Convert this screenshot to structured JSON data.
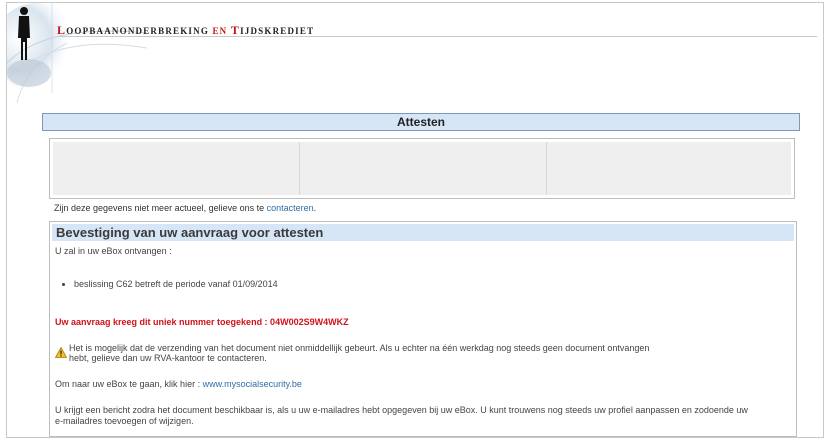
{
  "header": {
    "title_part1_cap": "L",
    "title_part1_rest": "OOPBAANONDERBREKING",
    "title_connector": "EN",
    "title_part2_cap": "T",
    "title_part2_rest": "IJDSKREDIET"
  },
  "attesten": {
    "heading": "Attesten"
  },
  "notice": {
    "text": "Zijn deze gegevens niet meer actueel, gelieve ons te ",
    "link": "contacteren",
    "suffix": "."
  },
  "confirmation": {
    "title": "Bevestiging van uw aanvraag voor attesten",
    "intro": "U zal in uw eBox ontvangen :",
    "items": [
      "beslissing C62 betreft de periode vanaf 01/09/2014"
    ],
    "unique_number": "Uw aanvraag kreeg dit uniek nummer toegekend : 04W002S9W4WKZ",
    "warning_line1": "Het is mogelijk dat de verzending van het document niet onmiddellijk gebeurt. Als u echter na één werkdag nog steeds geen document ontvangen",
    "warning_line2": "hebt, gelieve dan uw RVA-kantoor te contacteren.",
    "ebox_text": "Om naar uw eBox te gaan, klik hier : ",
    "ebox_link": "www.mysocialsecurity.be",
    "info_line1": "U krijgt een bericht zodra het document beschikbaar is, als u uw e-mailadres hebt opgegeven bij uw eBox. U kunt trouwens nog steeds uw profiel aanpassen en zodoende uw",
    "info_line2": "e-mailadres toevoegen of wijzigen."
  },
  "colors": {
    "brand_red": "#c0141b",
    "header_blue": "#d6e6f7",
    "link_blue": "#2e6ea8",
    "alert_red": "#d0121a"
  },
  "icons": {
    "header": "silhouette-figure-icon",
    "warning": "warning-icon"
  }
}
